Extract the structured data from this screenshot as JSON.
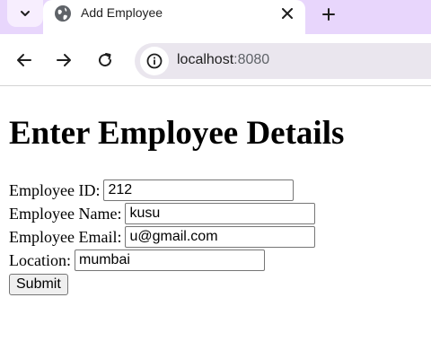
{
  "browser": {
    "tab": {
      "title": "Add Employee",
      "favicon": "globe-icon"
    },
    "address_bar": {
      "host": "localhost",
      "port": ":8080",
      "site_info_icon": "info-icon"
    },
    "colors": {
      "tabbar_background": "#e8d6fc",
      "omnibox_background": "#eae6ee"
    }
  },
  "page": {
    "heading": "Enter Employee Details",
    "form": {
      "fields": [
        {
          "label": "Employee ID:",
          "value": "212"
        },
        {
          "label": "Employee Name:",
          "value": "kusu"
        },
        {
          "label": "Employee Email:",
          "value": "u@gmail.com"
        },
        {
          "label": "Location:",
          "value": "mumbai"
        }
      ],
      "submit_label": "Submit"
    }
  }
}
